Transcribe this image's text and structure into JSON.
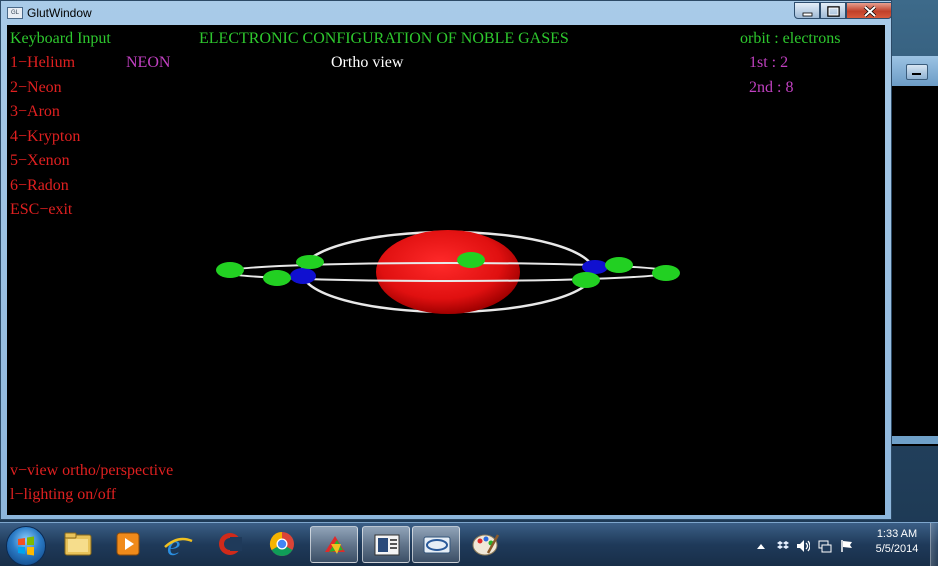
{
  "window": {
    "title": "GlutWindow",
    "icon_label": "GL"
  },
  "overlay": {
    "keyboard_heading": "Keyboard Input",
    "main_title": "ELECTRONIC CONFIGURATION OF NOBLE GASES",
    "orbit_heading": "orbit : electrons",
    "current_element": "NEON",
    "view_mode": "Ortho view",
    "menu_items": [
      "1−Helium",
      "2−Neon",
      "3−Aron",
      "4−Krypton",
      "5−Xenon",
      "6−Radon",
      "ESC−exit"
    ],
    "orbits": [
      "1st : 2",
      "2nd : 8"
    ],
    "footer_help": [
      "v−view ortho/perspective",
      "l−lighting on/off"
    ]
  },
  "colors": {
    "nucleus": "#e01010",
    "electron": "#22d022",
    "electron_blue": "#1010d0",
    "orbit": "#e8e8e8",
    "menu_text": "#e02020",
    "heading_text": "#2ec82e",
    "element_text": "#c040c0"
  },
  "taskbar": {
    "items": [
      {
        "name": "start-button",
        "icon": "windows-orb-icon"
      },
      {
        "name": "explorer",
        "icon": "folder-icon"
      },
      {
        "name": "media-player",
        "icon": "media-player-icon"
      },
      {
        "name": "internet-explorer",
        "icon": "ie-icon"
      },
      {
        "name": "ccleaner",
        "icon": "ccleaner-icon"
      },
      {
        "name": "chrome",
        "icon": "chrome-icon"
      },
      {
        "name": "app-colorful",
        "icon": "colorful-app-icon"
      },
      {
        "name": "document-app",
        "icon": "document-icon"
      },
      {
        "name": "glut-window",
        "icon": "opengl-icon"
      },
      {
        "name": "paint",
        "icon": "paint-icon"
      }
    ],
    "clock_time": "1:33 AM",
    "clock_date": "5/5/2014"
  }
}
